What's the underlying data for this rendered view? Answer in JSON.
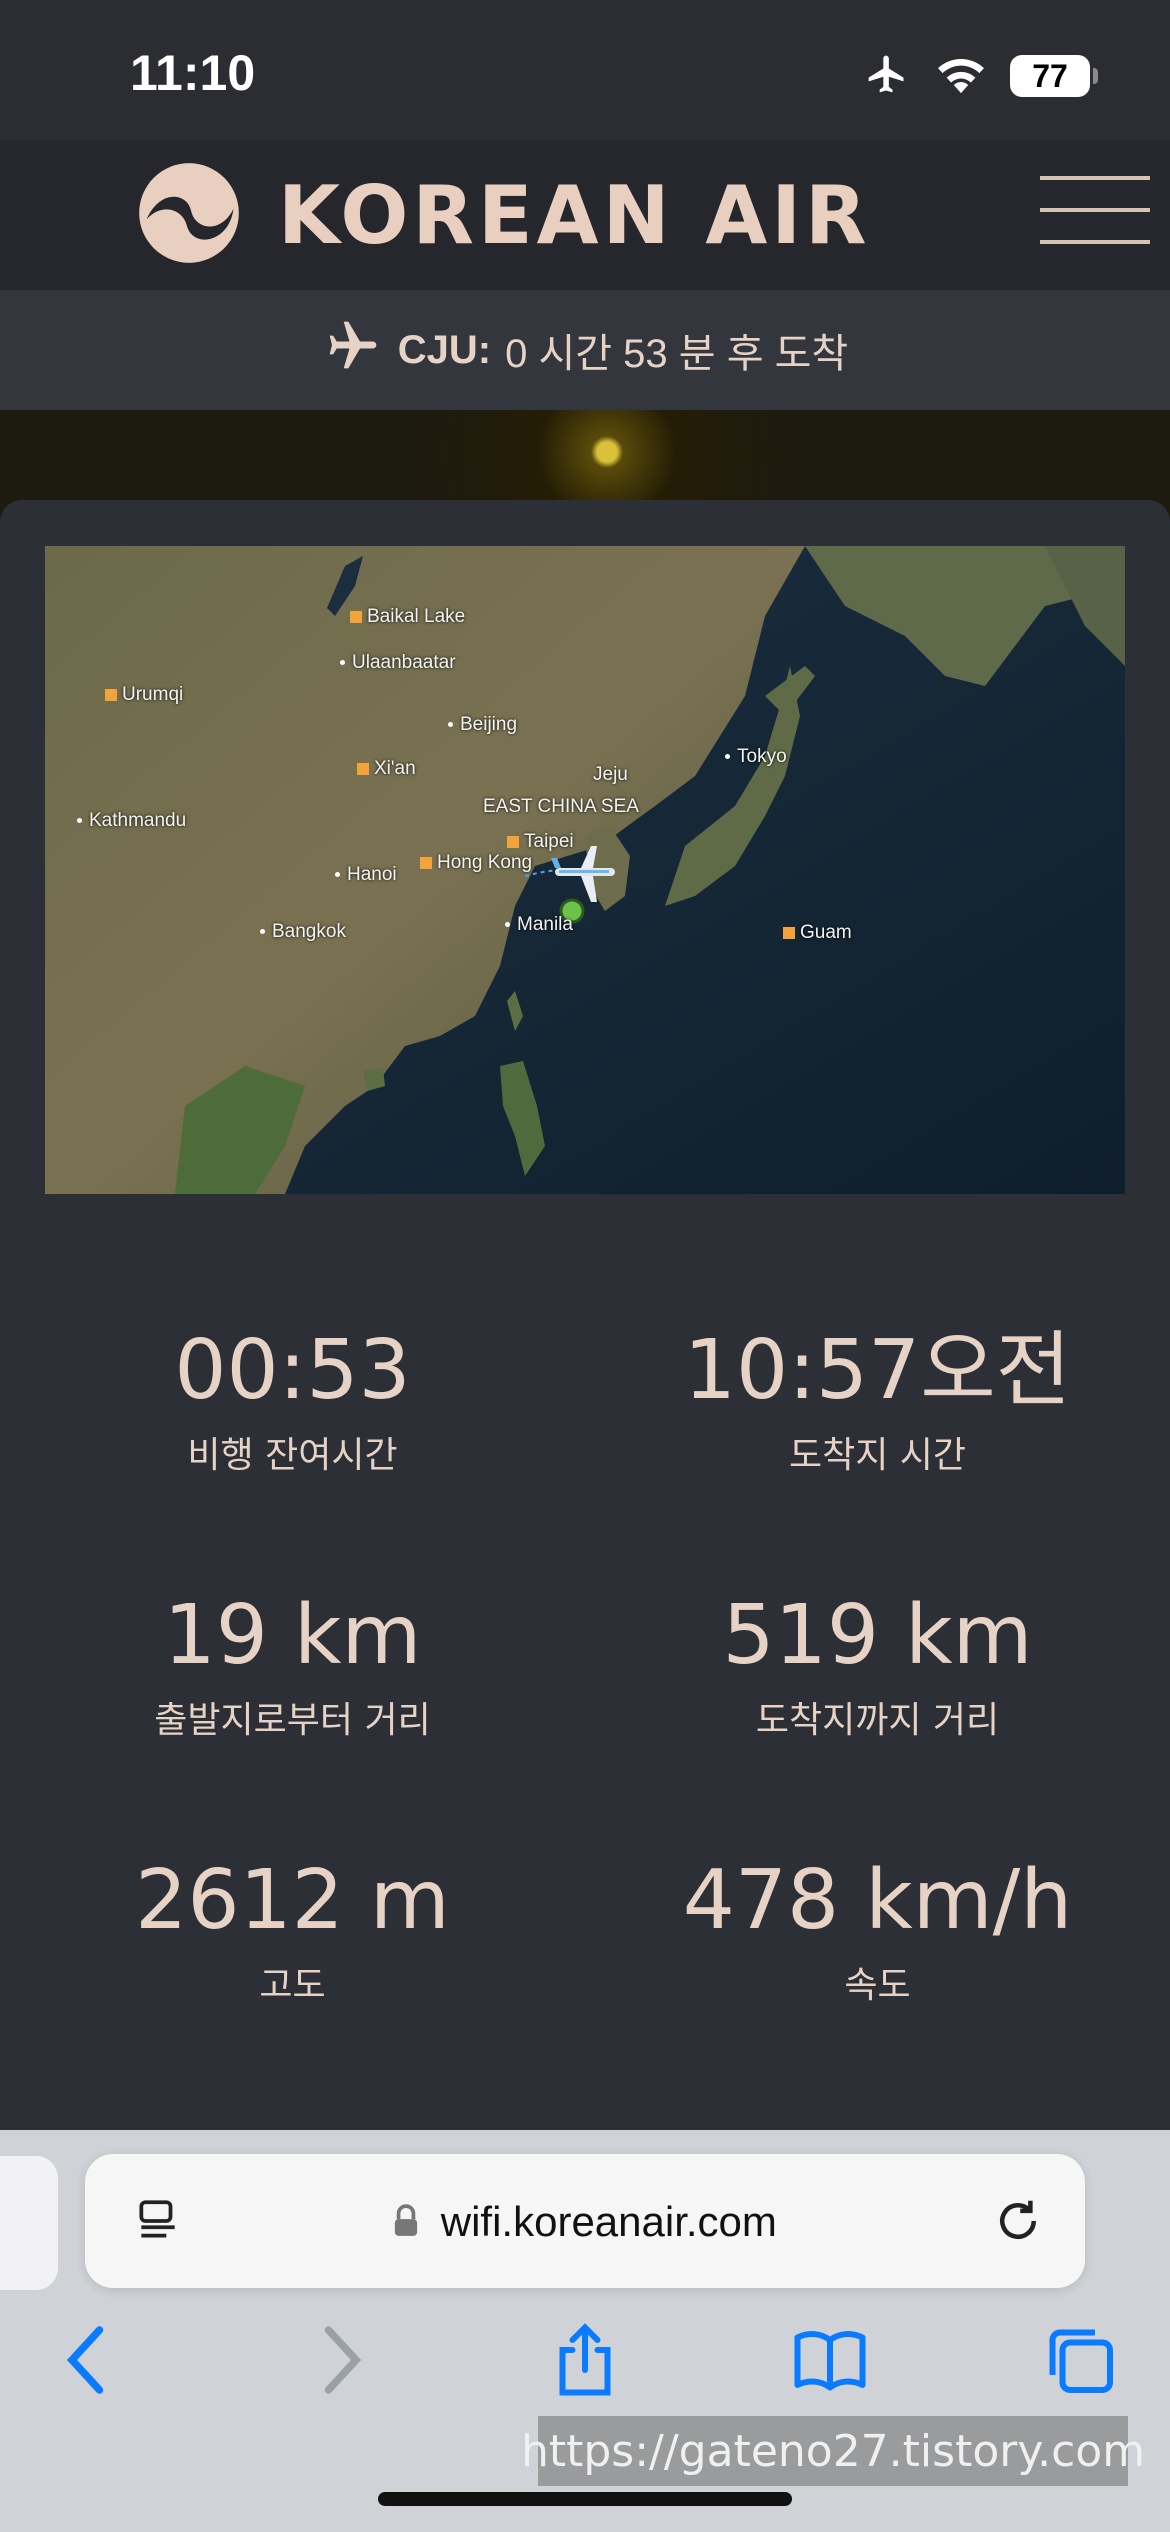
{
  "status_bar": {
    "time": "11:10",
    "battery": "77",
    "icons": [
      "airplane-mode-icon",
      "wifi-icon",
      "battery-icon"
    ]
  },
  "header": {
    "brand": "KOREAN AIR",
    "logo": "korean-air-taeguk-logo",
    "menu_icon": "hamburger-menu-icon"
  },
  "arrival": {
    "icon": "airplane-icon",
    "code": "CJU:",
    "text": "0 시간 53 분 후 도착"
  },
  "map": {
    "labels": {
      "baikal": "Baikal Lake",
      "ulaanbaatar": "Ulaanbaatar",
      "urumqi": "Urumqi",
      "beijing": "Beijing",
      "xian": "Xi'an",
      "jeju": "Jeju",
      "tokyo": "Tokyo",
      "kathmandu": "Kathmandu",
      "east_china_sea": "EAST CHINA SEA",
      "taipei": "Taipei",
      "hanoi": "Hanoi",
      "hong_kong": "Hong Kong",
      "bangkok": "Bangkok",
      "manila": "Manila",
      "guam": "Guam"
    }
  },
  "stats": {
    "time_remaining": {
      "value": "00:53",
      "label": "비행 잔여시간"
    },
    "arrival_time": {
      "value": "10:57오전",
      "label": "도착지 시간"
    },
    "distance_from": {
      "value": "19 km",
      "label": "출발지로부터 거리"
    },
    "distance_to": {
      "value": "519 km",
      "label": "도착지까지 거리"
    },
    "altitude": {
      "value": "2612 m",
      "label": "고도"
    },
    "speed": {
      "value": "478 km/h",
      "label": "속도"
    }
  },
  "browser": {
    "url": "wifi.koreanair.com",
    "icons": [
      "reader-icon",
      "lock-icon",
      "reload-icon",
      "back-icon",
      "forward-icon",
      "share-icon",
      "bookmarks-icon",
      "tabs-icon"
    ]
  },
  "watermark": "https://gateno27.tistory.com",
  "colors": {
    "background": "#2b2d33",
    "text": "#e6d3c5",
    "accent_marker": "#f2a43a",
    "browser_blue": "#0a7aff"
  }
}
